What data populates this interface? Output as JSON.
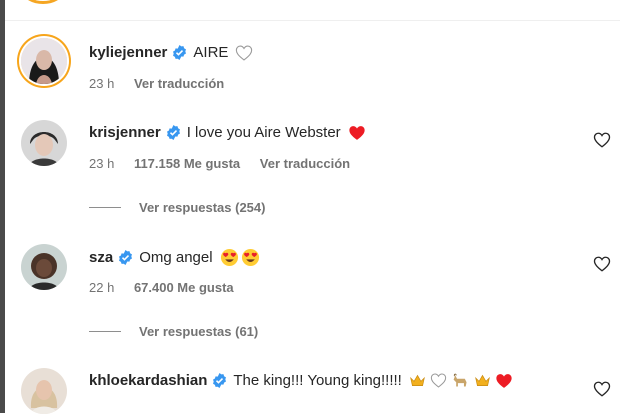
{
  "comments": [
    {
      "user": "kyliejenner",
      "text": "AIRE",
      "time": "23 h",
      "likes": "",
      "translate": "Ver traducción",
      "replies": ""
    },
    {
      "user": "krisjenner",
      "text": "I love you Aire Webster",
      "time": "23 h",
      "likes": "117.158 Me gusta",
      "translate": "Ver traducción",
      "replies": "Ver respuestas (254)"
    },
    {
      "user": "sza",
      "text": "Omg angel",
      "time": "22 h",
      "likes": "67.400 Me gusta",
      "translate": "",
      "replies": "Ver respuestas (61)"
    },
    {
      "user": "khloekardashian",
      "text": "The king!!! Young king!!!!!",
      "time": "",
      "likes": "",
      "translate": "",
      "replies": ""
    }
  ],
  "icons": {
    "verified": "verified-badge-icon",
    "like": "heart-outline-icon",
    "red_heart": "red-heart-emoji",
    "heart_eyes": "heart-eyes-emoji",
    "crown": "crown-emoji",
    "goat": "goat-emoji"
  },
  "colors": {
    "verified_blue": "#3897f0",
    "red_heart": "#ed1c24",
    "meta_gray": "#737373",
    "story_ring": "#f7a51b"
  }
}
